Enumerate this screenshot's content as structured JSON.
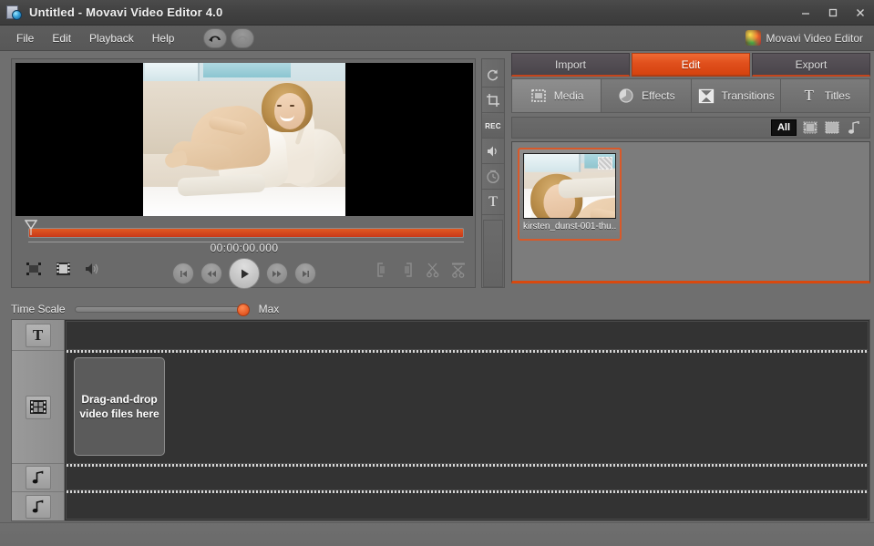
{
  "window": {
    "title": "Untitled - Movavi Video Editor 4.0",
    "app_icon": "movavi-project-icon",
    "minimize_label": "Minimize",
    "maximize_label": "Maximize",
    "close_label": "Close"
  },
  "menubar": {
    "items": [
      {
        "label": "File",
        "name": "menu-file"
      },
      {
        "label": "Edit",
        "name": "menu-edit"
      },
      {
        "label": "Playback",
        "name": "menu-playback"
      },
      {
        "label": "Help",
        "name": "menu-help"
      }
    ],
    "undo_label": "Undo",
    "redo_label": "Redo",
    "brand": "Movavi Video Editor"
  },
  "preview": {
    "timecode": "00:00:00.000",
    "seek_position_percent": 0,
    "controls": {
      "fullscreen_label": "Fit to screen",
      "snapshot_label": "Take snapshot",
      "volume_label": "Volume",
      "prev_label": "Previous frame",
      "rewind_label": "Rewind",
      "play_label": "Play",
      "forward_label": "Fast forward",
      "next_label": "Next frame",
      "mark_in_label": "Mark in",
      "mark_out_label": "Mark out",
      "split_label": "Split",
      "cut_label": "Cut"
    }
  },
  "vertical_toolbar": {
    "items": [
      {
        "label": "Rotate",
        "name": "rotate-icon"
      },
      {
        "label": "Crop",
        "name": "crop-icon"
      },
      {
        "label": "REC",
        "name": "record-icon"
      },
      {
        "label": "Audio",
        "name": "speaker-icon"
      },
      {
        "label": "Timer",
        "name": "clock-icon"
      },
      {
        "label": "T",
        "name": "text-icon"
      }
    ]
  },
  "right_panel": {
    "main_tabs": [
      {
        "label": "Import",
        "active": false
      },
      {
        "label": "Edit",
        "active": true
      },
      {
        "label": "Export",
        "active": false
      }
    ],
    "sub_tabs": [
      {
        "label": "Media",
        "icon": "media-icon",
        "active": true
      },
      {
        "label": "Effects",
        "icon": "effects-icon",
        "active": false
      },
      {
        "label": "Transitions",
        "icon": "transitions-icon",
        "active": false
      },
      {
        "label": "Titles",
        "icon": "titles-icon",
        "active": false
      }
    ],
    "filter_bar": {
      "all_label": "All",
      "video_filter_label": "Video",
      "image_filter_label": "Images",
      "audio_filter_label": "Audio"
    },
    "media_items": [
      {
        "name": "kirsten_dunst-001-thu...",
        "selected": true
      }
    ]
  },
  "timescale": {
    "label": "Time Scale",
    "max_label": "Max",
    "value_percent": 93
  },
  "timeline": {
    "tracks": [
      {
        "name": "titles-track",
        "icon": "text-icon",
        "label": "T"
      },
      {
        "name": "video-track",
        "icon": "film-icon",
        "label": ""
      },
      {
        "name": "audio-track-1",
        "icon": "music-note-icon",
        "label": ""
      },
      {
        "name": "audio-track-2",
        "icon": "music-note-icon",
        "label": ""
      }
    ],
    "dropzone_text": "Drag-and-drop video files here"
  },
  "colors": {
    "accent": "#d8490f",
    "accent_bright": "#e04f1c",
    "panel": "#6f6f6f",
    "track_bg": "#333333",
    "title_bar": "#414141"
  }
}
